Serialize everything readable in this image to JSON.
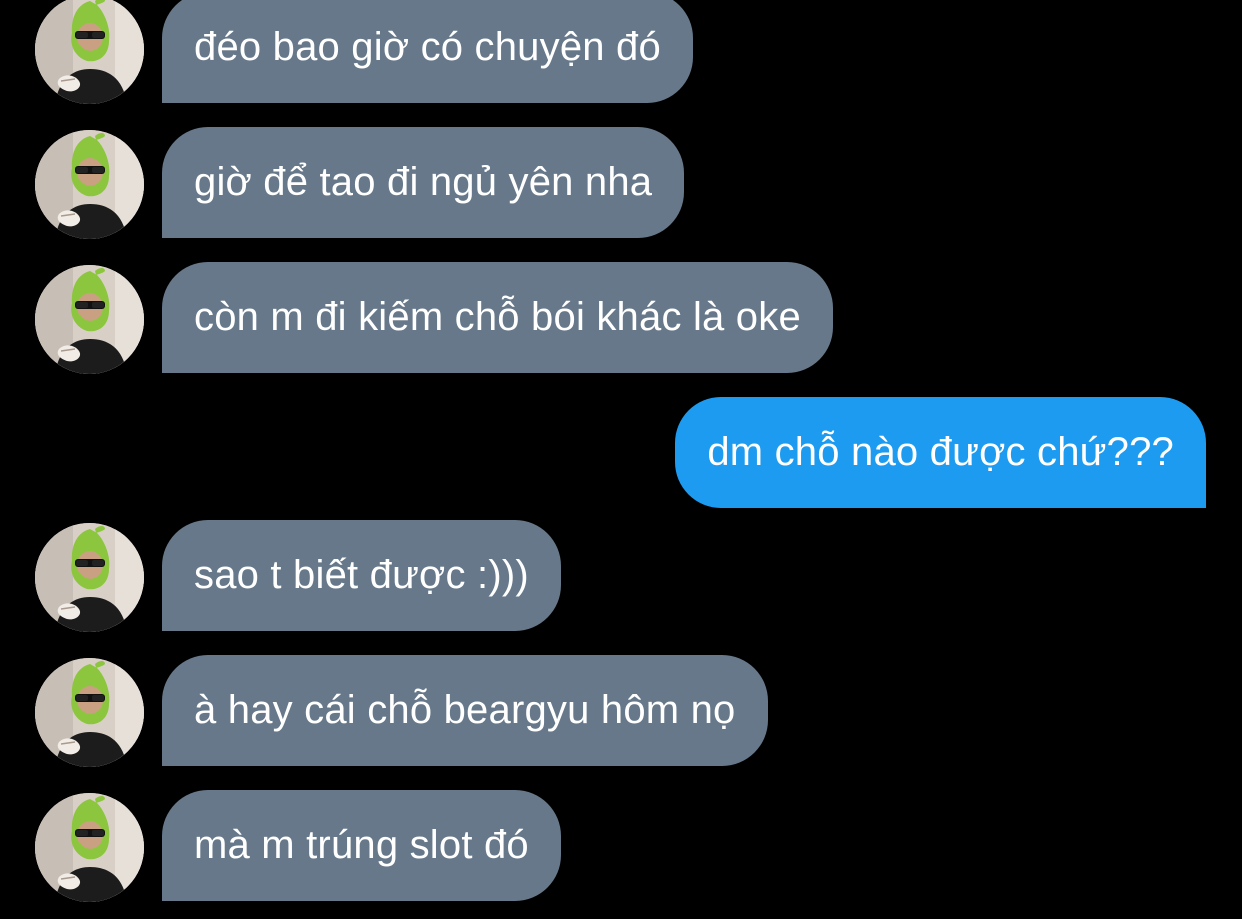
{
  "colors": {
    "background": "#000000",
    "incoming_bubble": "#66788a",
    "outgoing_bubble": "#1d9bf0",
    "text": "#ffffff",
    "avatar_hood": "#8cc63f"
  },
  "conversation": {
    "messages": [
      {
        "direction": "incoming",
        "text": "đéo bao giờ có chuyện đó",
        "avatar_icon": "avatar-green-hood-sunglasses"
      },
      {
        "direction": "incoming",
        "text": "giờ để tao đi ngủ yên nha",
        "avatar_icon": "avatar-green-hood-sunglasses"
      },
      {
        "direction": "incoming",
        "text": "còn m đi kiếm chỗ bói khác là oke",
        "avatar_icon": "avatar-green-hood-sunglasses"
      },
      {
        "direction": "outgoing",
        "text": "dm chỗ nào được chứ???"
      },
      {
        "direction": "incoming",
        "text": "sao t biết được :)))",
        "avatar_icon": "avatar-green-hood-sunglasses"
      },
      {
        "direction": "incoming",
        "text": "à hay cái chỗ beargyu hôm nọ",
        "avatar_icon": "avatar-green-hood-sunglasses"
      },
      {
        "direction": "incoming",
        "text": "mà m trúng slot đó",
        "avatar_icon": "avatar-green-hood-sunglasses"
      }
    ]
  }
}
